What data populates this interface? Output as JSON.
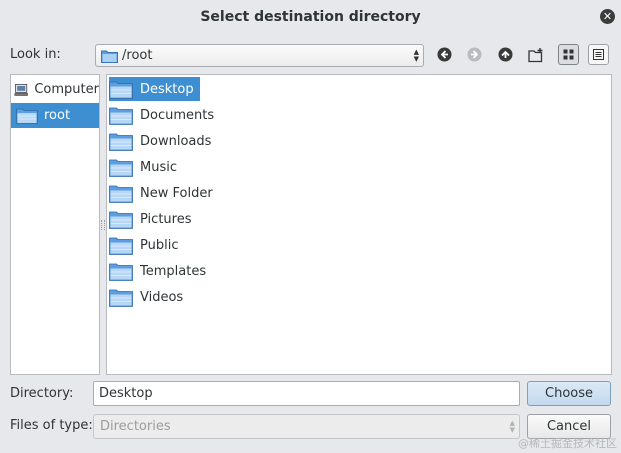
{
  "window": {
    "title": "Select destination directory",
    "close_icon": "close-icon"
  },
  "toolbar": {
    "look_in_label": "Look in:",
    "path": "/root",
    "buttons": [
      "back-icon",
      "forward-icon",
      "up-icon",
      "new-folder-icon",
      "icon-view-icon",
      "detail-view-icon"
    ]
  },
  "sidebar": {
    "items": [
      {
        "label": "Computer",
        "icon": "computer-icon",
        "selected": false
      },
      {
        "label": "root",
        "icon": "folder-icon",
        "selected": true
      }
    ]
  },
  "files": {
    "items": [
      {
        "label": "Desktop",
        "selected": true
      },
      {
        "label": "Documents",
        "selected": false
      },
      {
        "label": "Downloads",
        "selected": false
      },
      {
        "label": "Music",
        "selected": false
      },
      {
        "label": "New Folder",
        "selected": false
      },
      {
        "label": "Pictures",
        "selected": false
      },
      {
        "label": "Public",
        "selected": false
      },
      {
        "label": "Templates",
        "selected": false
      },
      {
        "label": "Videos",
        "selected": false
      }
    ]
  },
  "footer": {
    "directory_label": "Directory:",
    "directory_value": "Desktop",
    "types_label": "Files of type:",
    "types_value": "Directories",
    "choose_label": "Choose",
    "cancel_label": "Cancel"
  },
  "watermark": "@稀土掘金技术社区",
  "colors": {
    "selection": "#3d8fd1",
    "background": "#e7e8eb",
    "folder": "#6aa9e6"
  }
}
